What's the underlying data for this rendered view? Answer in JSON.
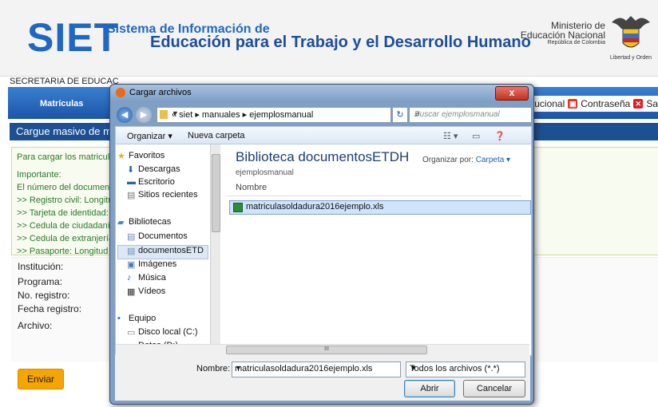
{
  "header": {
    "logo": "SIET",
    "title_line1": "Sistema de Información de",
    "title_line2": "Educación para el Trabajo y el Desarrollo Humano",
    "ministry_line1": "Ministerio de",
    "ministry_line2": "Educación Nacional",
    "ministry_line3": "República de Colombia",
    "motto": "Libertad y Orden"
  },
  "secretaria": "SECRETARIA DE EDUCAC",
  "nav": {
    "matriculas": "Matrículas",
    "institucional": "nstitucional",
    "contrasena": "Contraseña",
    "salir": "Sa"
  },
  "section_title": "Cargue masivo de mat",
  "info": {
    "line1": "Para cargar los matriculad",
    "line2": "Importante:",
    "line3": "El número del documento",
    "line4": ">> Registro civil: Longitud",
    "line5": ">> Tarjeta de identidad: L",
    "line6": ">> Cedula de ciudadanía:",
    "line7": ">> Cedula de extranjería:",
    "line8": ">> Pasaporte: Longitud en"
  },
  "form": {
    "institucion": "Institución:",
    "programa": "Programa:",
    "registro": "No. registro:",
    "fecha": "Fecha registro:",
    "archivo": "Archivo:"
  },
  "enviar": "Enviar",
  "dialog": {
    "title": "Cargar archivos",
    "close": "x",
    "path": "« siet ▸ manuales ▸ ejemplosmanual",
    "search_placeholder": "Buscar ejemplosmanual",
    "organizar": "Organizar ▾",
    "nueva_carpeta": "Nueva carpeta",
    "nav_items": [
      "Favoritos",
      "Descargas",
      "Escritorio",
      "Sitios recientes",
      "Bibliotecas",
      "Documentos",
      "documentosETD",
      "Imágenes",
      "Música",
      "Vídeos",
      "Equipo",
      "Disco local (C:)",
      "Datos (D:)"
    ],
    "library_title": "Biblioteca documentosETDH",
    "library_sub": "ejemplosmanual",
    "organizar_por_label": "Organizar por:",
    "organizar_por_value": "Carpeta ▾",
    "col_nombre": "Nombre",
    "file": "matriculasoldadura2016ejemplo.xls",
    "nombre_label": "Nombre:",
    "nombre_value": "matriculasoldadura2016ejemplo.xls",
    "tipo": "Todos los archivos (*.*)",
    "abrir": "Abrir",
    "cancelar": "Cancelar",
    "scroll_thumb": "III"
  }
}
